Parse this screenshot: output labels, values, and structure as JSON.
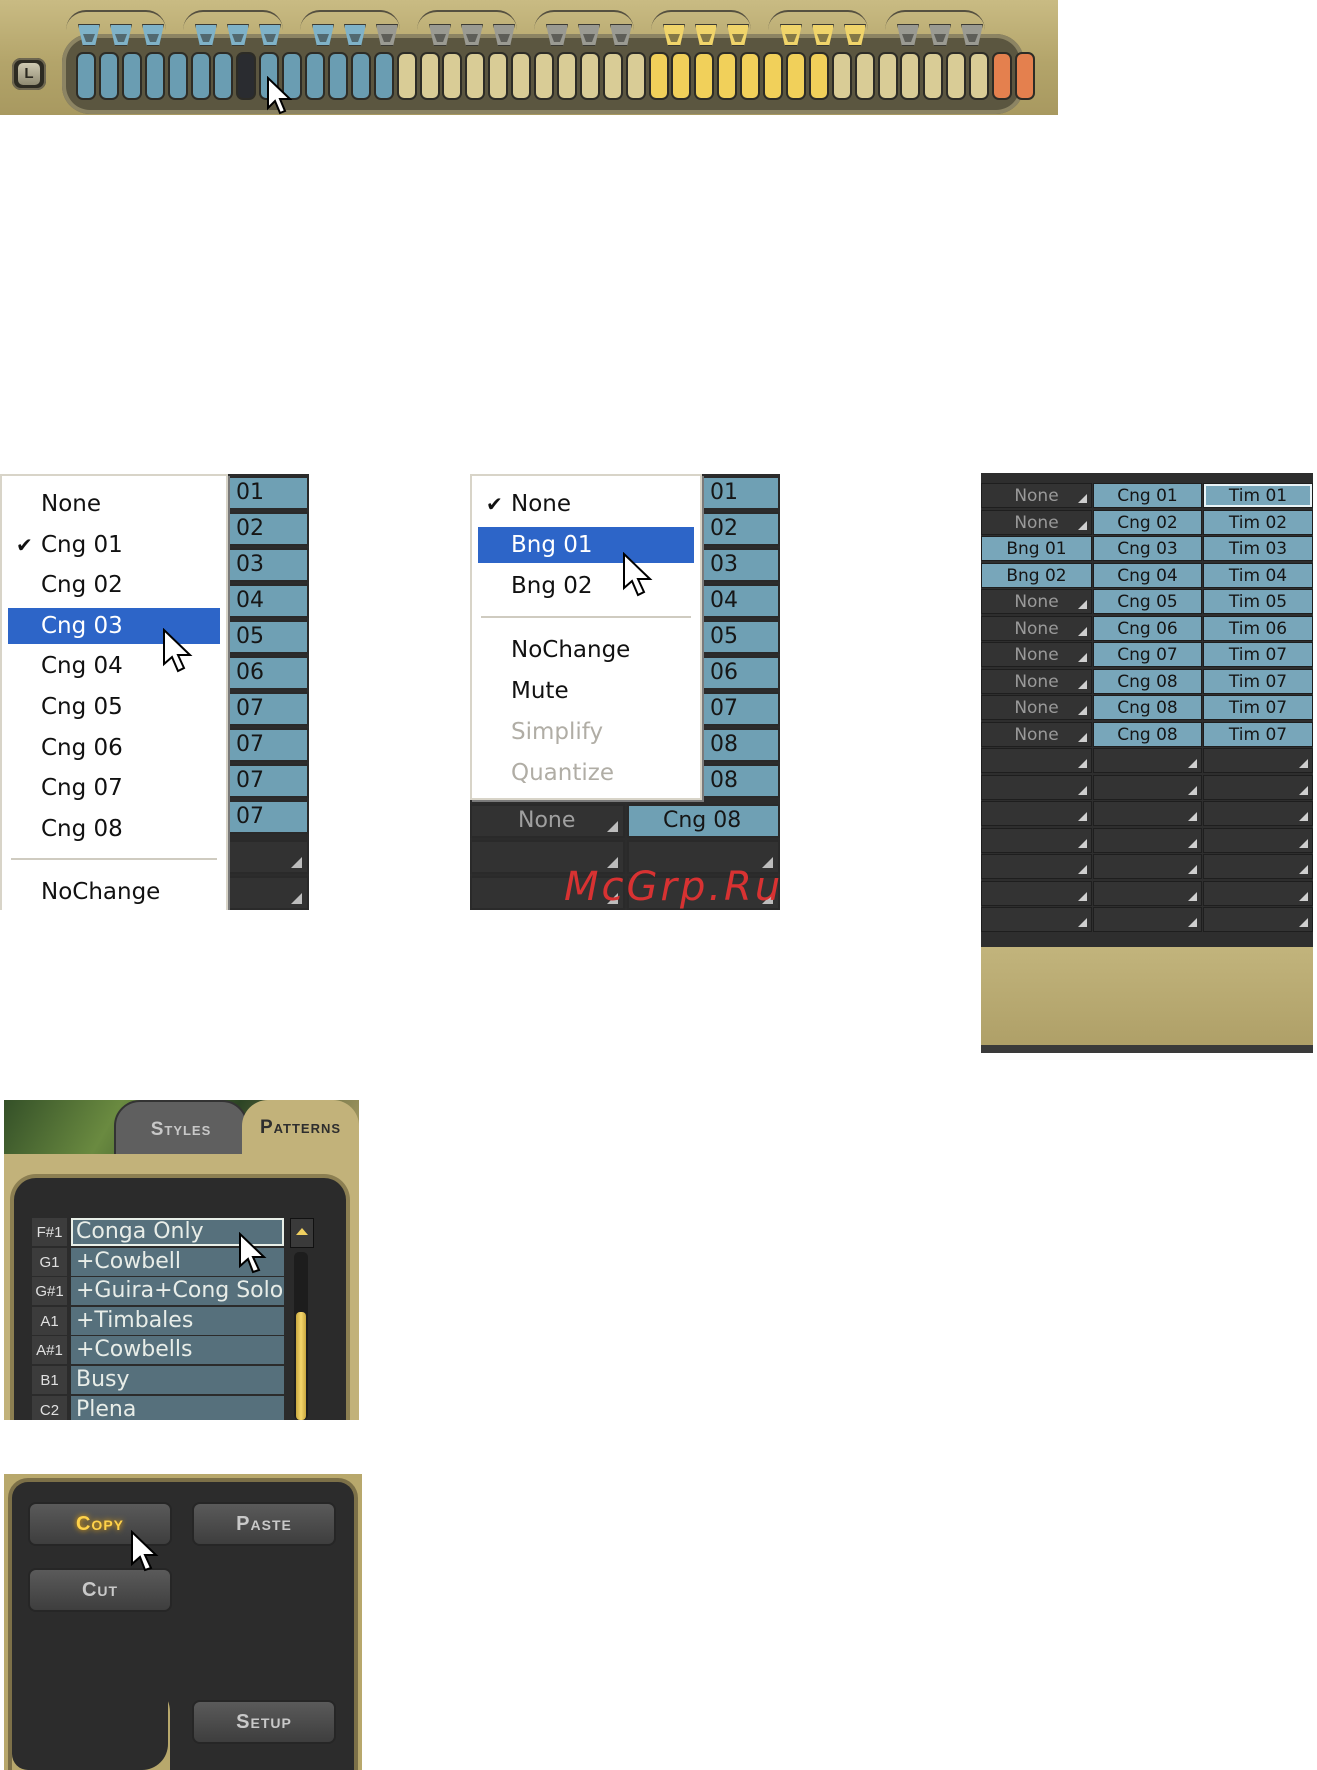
{
  "key_strip": {
    "lock_button_label": "L",
    "keys": [
      "blue",
      "blue",
      "blue",
      "blue",
      "blue",
      "blue",
      "blue",
      "selected",
      "blue",
      "blue",
      "blue",
      "blue",
      "blue",
      "blue",
      "tan",
      "tan",
      "tan",
      "tan",
      "tan",
      "tan",
      "tan",
      "tan",
      "tan",
      "tan",
      "tan",
      "yellow",
      "yellow",
      "yellow",
      "yellow",
      "yellow",
      "yellow",
      "yellow",
      "yellow",
      "tan",
      "tan",
      "tan",
      "tan",
      "tan",
      "tan",
      "tan",
      "orange",
      "orange"
    ],
    "cups": [
      "blue",
      "blue",
      "blue",
      "blue",
      "blue",
      "blue",
      "blue",
      "blue",
      "gray",
      "gray",
      "gray",
      "gray",
      "gray",
      "gray",
      "gray",
      "yellow",
      "yellow",
      "yellow",
      "yellow",
      "yellow",
      "yellow",
      "gray",
      "gray",
      "gray"
    ],
    "colors": {
      "blue": "#6a9db2",
      "tan": "#d9cc96",
      "yellow": "#f1d05a",
      "orange": "#e4804e",
      "selected": "#2a2c30",
      "cup_blue": "#7fb2c8",
      "cup_gray": "#9a9a92",
      "cup_yellow": "#f0d46a"
    }
  },
  "conga_menu": {
    "items": [
      {
        "label": "None",
        "checked": false,
        "highlighted": false
      },
      {
        "label": "Cng 01",
        "checked": true,
        "highlighted": false
      },
      {
        "label": "Cng 02",
        "checked": false,
        "highlighted": false
      },
      {
        "label": "Cng 03",
        "checked": false,
        "highlighted": true
      },
      {
        "label": "Cng 04",
        "checked": false,
        "highlighted": false
      },
      {
        "label": "Cng 05",
        "checked": false,
        "highlighted": false
      },
      {
        "label": "Cng 06",
        "checked": false,
        "highlighted": false
      },
      {
        "label": "Cng 07",
        "checked": false,
        "highlighted": false
      },
      {
        "label": "Cng 08",
        "checked": false,
        "highlighted": false
      }
    ],
    "after_separator": "NoChange",
    "background_cells": [
      "01",
      "02",
      "03",
      "04",
      "05",
      "06",
      "07",
      "07",
      "07",
      "07"
    ]
  },
  "bongo_menu": {
    "items": [
      {
        "label": "None",
        "checked": true,
        "highlighted": false
      },
      {
        "label": "Bng 01",
        "checked": false,
        "highlighted": true
      },
      {
        "label": "Bng 02",
        "checked": false,
        "highlighted": false
      }
    ],
    "after_separator": [
      {
        "label": "NoChange",
        "disabled": false
      },
      {
        "label": "Mute",
        "disabled": false
      },
      {
        "label": "Simplify",
        "disabled": true
      },
      {
        "label": "Quantize",
        "disabled": true
      }
    ],
    "background_cells": [
      "01",
      "02",
      "03",
      "04",
      "05",
      "06",
      "07",
      "08",
      "08"
    ],
    "bottom_row": {
      "left": "None",
      "right": "Cng 08"
    }
  },
  "mapping_grid": {
    "rows": [
      [
        "None",
        "Cng 01",
        "Tim 01"
      ],
      [
        "None",
        "Cng 02",
        "Tim 02"
      ],
      [
        "Bng 01",
        "Cng 03",
        "Tim 03"
      ],
      [
        "Bng 02",
        "Cng 04",
        "Tim 04"
      ],
      [
        "None",
        "Cng 05",
        "Tim 05"
      ],
      [
        "None",
        "Cng 06",
        "Tim 06"
      ],
      [
        "None",
        "Cng 07",
        "Tim 07"
      ],
      [
        "None",
        "Cng 08",
        "Tim 07"
      ],
      [
        "None",
        "Cng 08",
        "Tim 07"
      ],
      [
        "None",
        "Cng 08",
        "Tim 07"
      ]
    ],
    "empty_rows": 7
  },
  "patterns_panel": {
    "tabs": [
      "Styles",
      "Patterns"
    ],
    "active_tab": "Patterns",
    "items": [
      {
        "note": "F#1",
        "name": "Conga Only",
        "selected": true
      },
      {
        "note": "G1",
        "name": "+Cowbell",
        "selected": false
      },
      {
        "note": "G#1",
        "name": "+Guira+Cong Solo",
        "selected": false
      },
      {
        "note": "A1",
        "name": "+Timbales",
        "selected": false
      },
      {
        "note": "A#1",
        "name": "+Cowbells",
        "selected": false
      },
      {
        "note": "B1",
        "name": "Busy",
        "selected": false
      },
      {
        "note": "C2",
        "name": "Plena",
        "selected": false
      }
    ]
  },
  "edit_panel": {
    "copy_label": "Copy",
    "paste_label": "Paste",
    "cut_label": "Cut",
    "setup_label": "Setup"
  },
  "watermark": "McGrp.Ru"
}
